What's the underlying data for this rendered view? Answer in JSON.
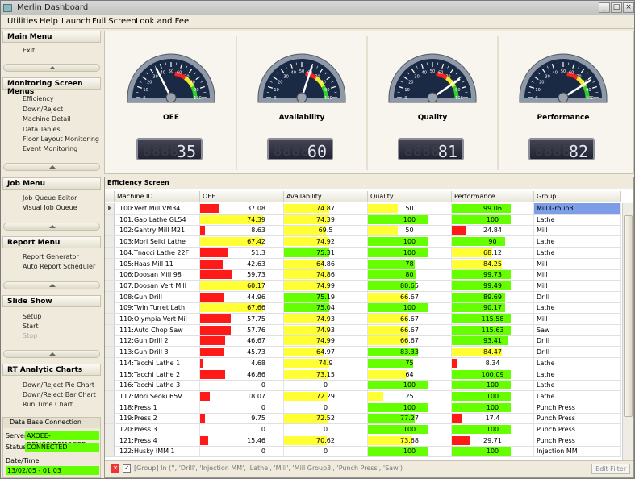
{
  "window": {
    "title": "Merlin Dashboard"
  },
  "menubar": [
    "Utilities",
    "Help",
    "Launch",
    "Full Screen",
    "Look and Feel"
  ],
  "sidebar": {
    "sections": [
      {
        "title": "Main Menu",
        "items": [
          "Exit"
        ]
      },
      {
        "title": "Monitoring Screen Menus",
        "items": [
          "Efficiency",
          "Down/Reject",
          "Machine Detail",
          "Data Tables",
          "Floor Layout Monitoring",
          "Event Monitoring"
        ]
      },
      {
        "title": "Job Menu",
        "items": [
          "Job Queue Editor",
          "Visual Job Queue"
        ]
      },
      {
        "title": "Report Menu",
        "items": [
          "Report Generator",
          "Auto Report Scheduler"
        ]
      },
      {
        "title": "Slide Show",
        "items": [
          "Setup",
          "Start",
          "Stop"
        ]
      },
      {
        "title": "RT Analytic Charts",
        "items": [
          "Down/Reject Pie Chart",
          "Down/Reject Bar Chart",
          "Run Time Chart"
        ]
      }
    ],
    "db": {
      "title": "Data Base Connection",
      "server_label": "Server",
      "server": "AXOEE-DEMO2\\DEMOOEE",
      "status_label": "Status",
      "status": "CONNECTED",
      "datetime_label": "Date/Time",
      "datetime": "13/02/05 - 01:03"
    }
  },
  "gauges": [
    {
      "label": "OEE",
      "value": 35,
      "display": "35",
      "ghost": "8888"
    },
    {
      "label": "Availability",
      "value": 60,
      "display": "60",
      "ghost": "8888"
    },
    {
      "label": "Quality",
      "value": 81,
      "display": "81",
      "ghost": "8888"
    },
    {
      "label": "Performance",
      "value": 82,
      "display": "82",
      "ghost": "8888"
    }
  ],
  "gauge_scale": [
    "0",
    "10",
    "20",
    "30",
    "40",
    "50",
    "60",
    "70",
    "80",
    "90",
    "100"
  ],
  "grid": {
    "title": "Efficiency Screen",
    "headers": [
      "Machine ID",
      "OEE",
      "Availability",
      "Quality",
      "Performance",
      "Group"
    ],
    "colors": {
      "red": "#ff1a1a",
      "yellow": "#ffff33",
      "green": "#66ff00",
      "selected": "#7d9ee6"
    },
    "rows": [
      {
        "name": "100:Vert Mill VM34",
        "oee": "37.08",
        "avail": "74.87",
        "qual": "50",
        "perf": "99.06",
        "group": "Mill  Group3"
      },
      {
        "name": "101:Gap Lathe GL54",
        "oee": "74.39",
        "avail": "74.39",
        "qual": "100",
        "perf": "100",
        "group": "Lathe"
      },
      {
        "name": "102:Gantry Mill M21",
        "oee": "8.63",
        "avail": "69.5",
        "qual": "50",
        "perf": "24.84",
        "group": "Mill"
      },
      {
        "name": "103:Mori Seiki Lathe",
        "oee": "67.42",
        "avail": "74.92",
        "qual": "100",
        "perf": "90",
        "group": "Lathe"
      },
      {
        "name": "104:Tnacci Lathe 22F",
        "oee": "51.3",
        "avail": "75.31",
        "qual": "100",
        "perf": "68.12",
        "group": "Lathe"
      },
      {
        "name": "105:Haas Mill 11",
        "oee": "42.63",
        "avail": "64.86",
        "qual": "78",
        "perf": "84.25",
        "group": "Mill"
      },
      {
        "name": "106:Doosan Mill 98",
        "oee": "59.73",
        "avail": "74.86",
        "qual": "80",
        "perf": "99.73",
        "group": "Mill"
      },
      {
        "name": "107:Doosan Vert Mill",
        "oee": "60.17",
        "avail": "74.99",
        "qual": "80.65",
        "perf": "99.49",
        "group": "Mill"
      },
      {
        "name": "108:Gun Drill",
        "oee": "44.96",
        "avail": "75.19",
        "qual": "66.67",
        "perf": "89.69",
        "group": "Drill"
      },
      {
        "name": "109:Twin Turret Lath",
        "oee": "67.66",
        "avail": "75.04",
        "qual": "100",
        "perf": "90.17",
        "group": "Lathe"
      },
      {
        "name": "110:Olympia Vert Mil",
        "oee": "57.75",
        "avail": "74.93",
        "qual": "66.67",
        "perf": "115.58",
        "group": "Mill"
      },
      {
        "name": "111:Auto Chop Saw",
        "oee": "57.76",
        "avail": "74.93",
        "qual": "66.67",
        "perf": "115.63",
        "group": "Saw"
      },
      {
        "name": "112:Gun Drill 2",
        "oee": "46.67",
        "avail": "74.99",
        "qual": "66.67",
        "perf": "93.41",
        "group": "Drill"
      },
      {
        "name": "113:Gun Drill 3",
        "oee": "45.73",
        "avail": "64.97",
        "qual": "83.33",
        "perf": "84.47",
        "group": "Drill"
      },
      {
        "name": "114:Tacchi Lathe 1",
        "oee": "4.68",
        "avail": "74.9",
        "qual": "75",
        "perf": "8.34",
        "group": "Lathe"
      },
      {
        "name": "115:Tacchi Lathe 2",
        "oee": "46.86",
        "avail": "73.15",
        "qual": "64",
        "perf": "100.09",
        "group": "Lathe"
      },
      {
        "name": "116:Tacchi Lathe 3",
        "oee": "0",
        "avail": "0",
        "qual": "100",
        "perf": "100",
        "group": "Lathe"
      },
      {
        "name": "117:Mori Seoki 65V",
        "oee": "18.07",
        "avail": "72.29",
        "qual": "25",
        "perf": "100",
        "group": "Lathe"
      },
      {
        "name": "118:Press 1",
        "oee": "0",
        "avail": "0",
        "qual": "100",
        "perf": "100",
        "group": "Punch Press"
      },
      {
        "name": "119:Press 2",
        "oee": "9.75",
        "avail": "72.52",
        "qual": "77.27",
        "perf": "17.4",
        "group": "Punch Press"
      },
      {
        "name": "120:Press 3",
        "oee": "0",
        "avail": "0",
        "qual": "100",
        "perf": "100",
        "group": "Punch Press"
      },
      {
        "name": "121:Press 4",
        "oee": "15.46",
        "avail": "70.62",
        "qual": "73.68",
        "perf": "29.71",
        "group": "Punch Press"
      },
      {
        "name": "122:Husky IMM 1",
        "oee": "0",
        "avail": "0",
        "qual": "100",
        "perf": "100",
        "group": "Injection MM"
      }
    ],
    "filter": "[Group] In ('', 'Drill', 'Injection MM', 'Lathe', 'Mill', 'Mill  Group3', 'Punch Press', 'Saw')",
    "edit_filter": "Edit Filter"
  }
}
